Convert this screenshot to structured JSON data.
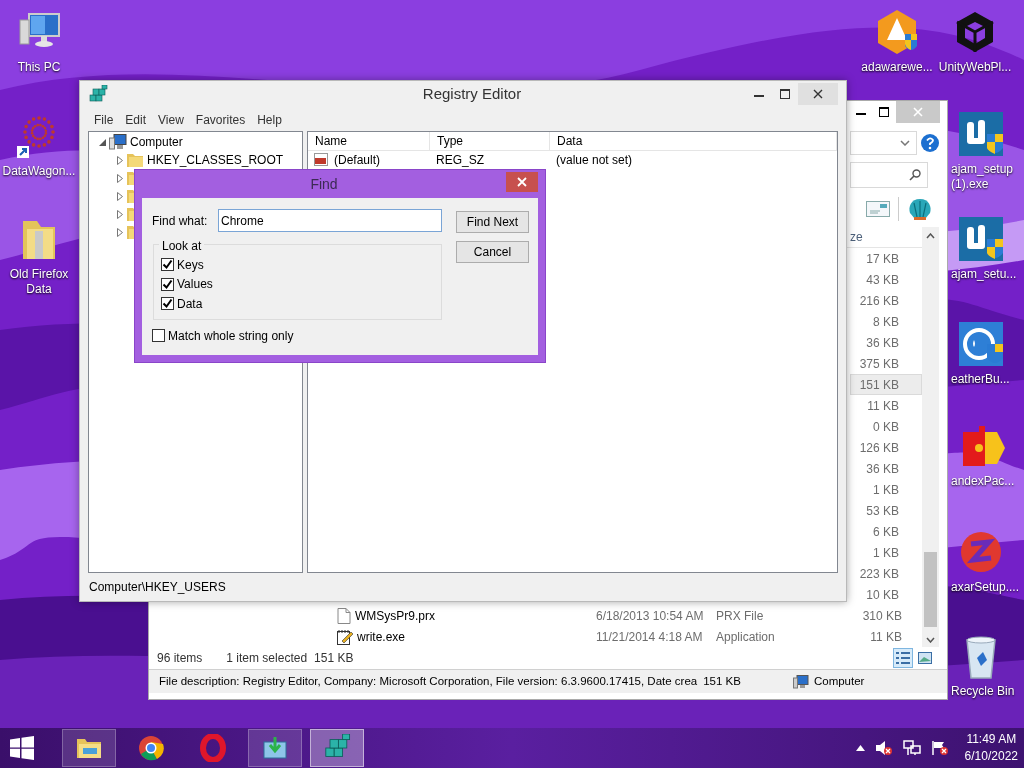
{
  "desktop_icons": [
    {
      "label": "This PC",
      "kind": "pc"
    },
    {
      "label": "DataWagon...",
      "kind": "network"
    },
    {
      "label": "Old Firefox Data",
      "kind": "folder"
    },
    {
      "label": "adawarewe...",
      "kind": "adaware"
    },
    {
      "label": "UnityWebPl...",
      "kind": "unity"
    },
    {
      "label": "ajam_setup (1).exe",
      "kind": "setup"
    },
    {
      "label": "ajam_setu...",
      "kind": "setup"
    },
    {
      "label": "eatherBu...",
      "kind": "weather"
    },
    {
      "label": "andexPac...",
      "kind": "puzzle"
    },
    {
      "label": "axarSetup....",
      "kind": "zaxar"
    },
    {
      "label": "Recycle Bin",
      "kind": "bin"
    }
  ],
  "explorer": {
    "size_header": "ze",
    "rows": [
      {
        "size": "17 KB",
        "selected": false
      },
      {
        "size": "43 KB",
        "selected": false
      },
      {
        "size": "216 KB",
        "selected": false
      },
      {
        "size": "8 KB",
        "selected": false
      },
      {
        "size": "36 KB",
        "selected": false
      },
      {
        "size": "375 KB",
        "selected": false
      },
      {
        "size": "151 KB",
        "selected": true
      },
      {
        "size": "11 KB",
        "selected": false
      },
      {
        "size": "0 KB",
        "selected": false
      },
      {
        "size": "126 KB",
        "selected": false
      },
      {
        "size": "36 KB",
        "selected": false
      },
      {
        "size": "1 KB",
        "selected": false
      },
      {
        "size": "53 KB",
        "selected": false
      },
      {
        "size": "6 KB",
        "selected": false
      },
      {
        "size": "1 KB",
        "selected": false
      },
      {
        "size": "223 KB",
        "selected": false
      },
      {
        "size": "10 KB",
        "selected": false
      },
      {
        "name": "WMSysPr9.prx",
        "date": "6/18/2013 10:54 AM",
        "type": "PRX File",
        "size": "310 KB",
        "kind": "file",
        "selected": false
      },
      {
        "name": "write.exe",
        "date": "11/21/2014 4:18 AM",
        "type": "Application",
        "size": "11 KB",
        "kind": "app",
        "selected": false
      }
    ],
    "item_count": "96 items",
    "selection": "1 item selected",
    "selection_size": "151 KB",
    "view_buttons": [
      {
        "kind": "details",
        "selected": true
      },
      {
        "kind": "preview",
        "selected": false
      }
    ],
    "details": "File description: Registry Editor, Company: Microsoft Corporation, File version: 6.3.9600.17415, Date crea",
    "details_size": "151 KB",
    "location": "Computer"
  },
  "registry": {
    "title": "Registry Editor",
    "menu": [
      "File",
      "Edit",
      "View",
      "Favorites",
      "Help"
    ],
    "tree": {
      "label": "Computer",
      "expanded": true,
      "children": [
        {
          "label": "HKEY_CLASSES_ROOT",
          "expanded": false
        },
        {
          "expanded": false
        },
        {
          "expanded": false
        },
        {
          "expanded": false
        },
        {
          "expanded": false
        }
      ]
    },
    "columns": [
      "Name",
      "Type",
      "Data"
    ],
    "values": [
      {
        "name": "(Default)",
        "type": "REG_SZ",
        "data": "(value not set)"
      }
    ],
    "status": "Computer\\HKEY_USERS"
  },
  "find_dialog": {
    "title": "Find",
    "find_what_label": "Find what:",
    "find_what": "Chrome",
    "buttons": [
      "Find Next",
      "Cancel"
    ],
    "look_at_label": "Look at",
    "options": [
      {
        "label": "Keys",
        "checked": true
      },
      {
        "label": "Values",
        "checked": true
      },
      {
        "label": "Data",
        "checked": true
      }
    ],
    "match_whole": {
      "label": "Match whole string only",
      "checked": false
    }
  },
  "taskbar": {
    "apps": [
      {
        "kind": "explorer",
        "running": true,
        "active": false
      },
      {
        "kind": "chrome",
        "running": false,
        "active": false
      },
      {
        "kind": "opera",
        "running": false,
        "active": false
      },
      {
        "kind": "installer",
        "running": true,
        "active": false
      },
      {
        "kind": "regedit",
        "running": true,
        "active": true
      }
    ],
    "time": "11:49 AM",
    "date": "6/10/2022"
  }
}
